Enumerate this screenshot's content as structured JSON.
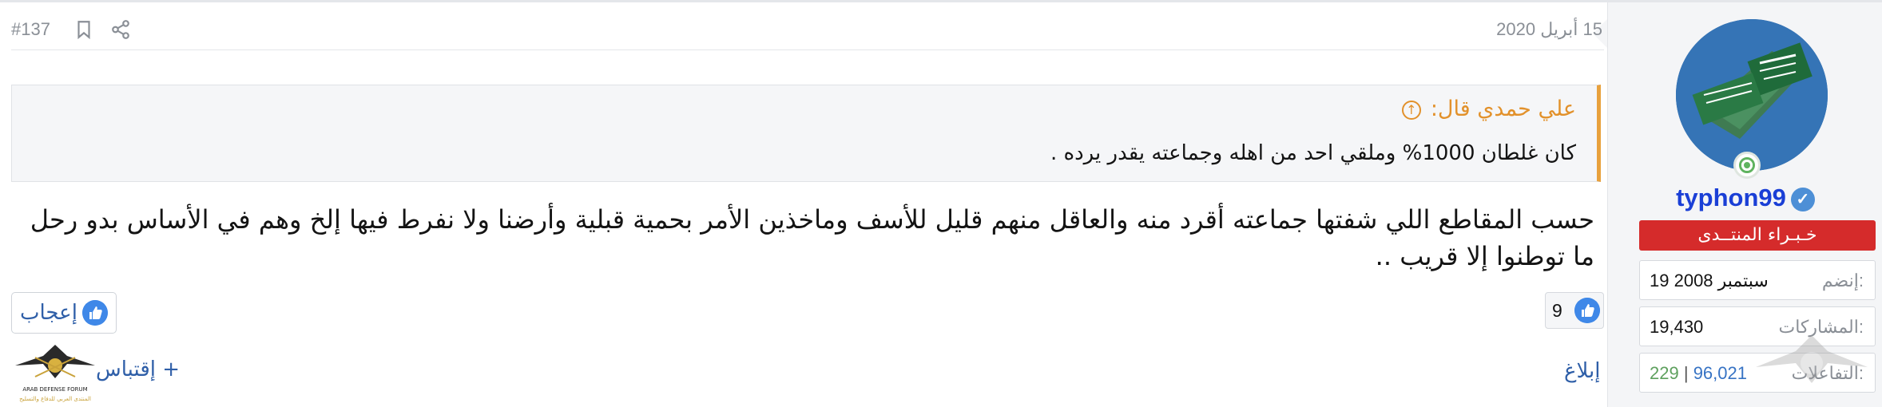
{
  "post": {
    "date": "15 أبريل 2020",
    "number": "#137",
    "quote": {
      "author": "علي حمدي قال:",
      "text": "كان غلطان 1000% وملقي احد من اهله وجماعته يقدر يرده ."
    },
    "body_line1": "حسب المقاطع اللي شفتها جماعته أقرد منه والعاقل منهم قليل للأسف وماخذين الأمر بحمية قبلية وأرضنا ولا نفرط فيها إلخ وهم في الأساس بدو رحل",
    "body_line2": "ما توطنوا إلا قريب ..",
    "reaction_count": "9",
    "like_label": "إعجاب",
    "report_label": "إبلاغ",
    "quote_label": "+ إقتباس"
  },
  "user": {
    "name": "typhon99",
    "rank": "خـبـراء المنتــدى",
    "joined_label": "إنضم:",
    "joined_value": "19 سبتمبر 2008",
    "posts_label": "المشاركات:",
    "posts_value": "19,430",
    "reactions_label": "التفاعلات:",
    "reactions_value": "96,021",
    "reactions_sep": "|",
    "points_value": "229"
  },
  "logo": {
    "text1": "ARAB DEFENSE FORUM",
    "text2": "المنتدى العربي للدفاع والتسليح"
  },
  "colors": {
    "accent": "#e8a13d",
    "link": "#2f5fa8",
    "rank_bg": "#d52b2b",
    "username": "#1a3fd6"
  },
  "icons": [
    "bookmark-icon",
    "share-icon",
    "verified-icon",
    "thumbs-up-icon",
    "up-arrow-icon",
    "online-icon"
  ]
}
